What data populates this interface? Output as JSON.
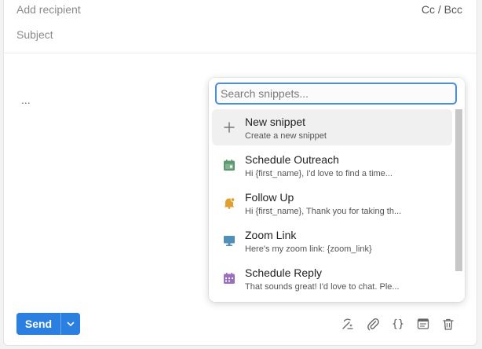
{
  "compose": {
    "recipient_placeholder": "Add recipient",
    "cc_bcc": "Cc / Bcc",
    "subject_placeholder": "Subject",
    "body_text": "..."
  },
  "send": {
    "label": "Send",
    "dropdown_icon": "chevron-down-icon",
    "color": "#2b7fe0"
  },
  "toolbar": {
    "icons": [
      "ai-sparkle-icon",
      "paperclip-icon",
      "curly-braces-icon",
      "template-icon",
      "trash-icon"
    ],
    "curly_label": "{}"
  },
  "snippets": {
    "search_placeholder": "Search snippets...",
    "items": [
      {
        "title": "New snippet",
        "subtitle": "Create a new snippet",
        "icon": "plus-icon",
        "color": "#777777"
      },
      {
        "title": "Schedule Outreach",
        "subtitle": "Hi {first_name}, I'd love to find a time...",
        "icon": "calendar-check-icon",
        "color": "#5b9a6e"
      },
      {
        "title": "Follow Up",
        "subtitle": "Hi {first_name}, Thank you for taking th...",
        "icon": "bell-icon",
        "color": "#e0a030"
      },
      {
        "title": "Zoom Link",
        "subtitle": "Here's my zoom link: {zoom_link}",
        "icon": "monitor-icon",
        "color": "#4f8fb8"
      },
      {
        "title": "Schedule Reply",
        "subtitle": "That sounds great! I'd love to chat. Ple...",
        "icon": "calendar-icon",
        "color": "#9a6ec2"
      }
    ]
  }
}
